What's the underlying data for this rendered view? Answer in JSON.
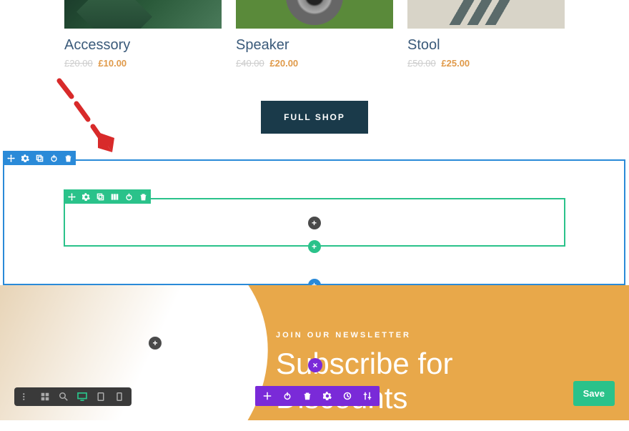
{
  "products": [
    {
      "title": "Accessory",
      "old_price": "£20.00",
      "new_price": "£10.00"
    },
    {
      "title": "Speaker",
      "old_price": "£40.00",
      "new_price": "£20.00"
    },
    {
      "title": "Stool",
      "old_price": "£50.00",
      "new_price": "£25.00"
    }
  ],
  "shop_button": "FULL SHOP",
  "newsletter": {
    "label": "JOIN OUR NEWSLETTER",
    "title_line1": "Subscribe for",
    "title_line2": "Discounts"
  },
  "save_button": "Save",
  "plus": "+",
  "close": "×"
}
